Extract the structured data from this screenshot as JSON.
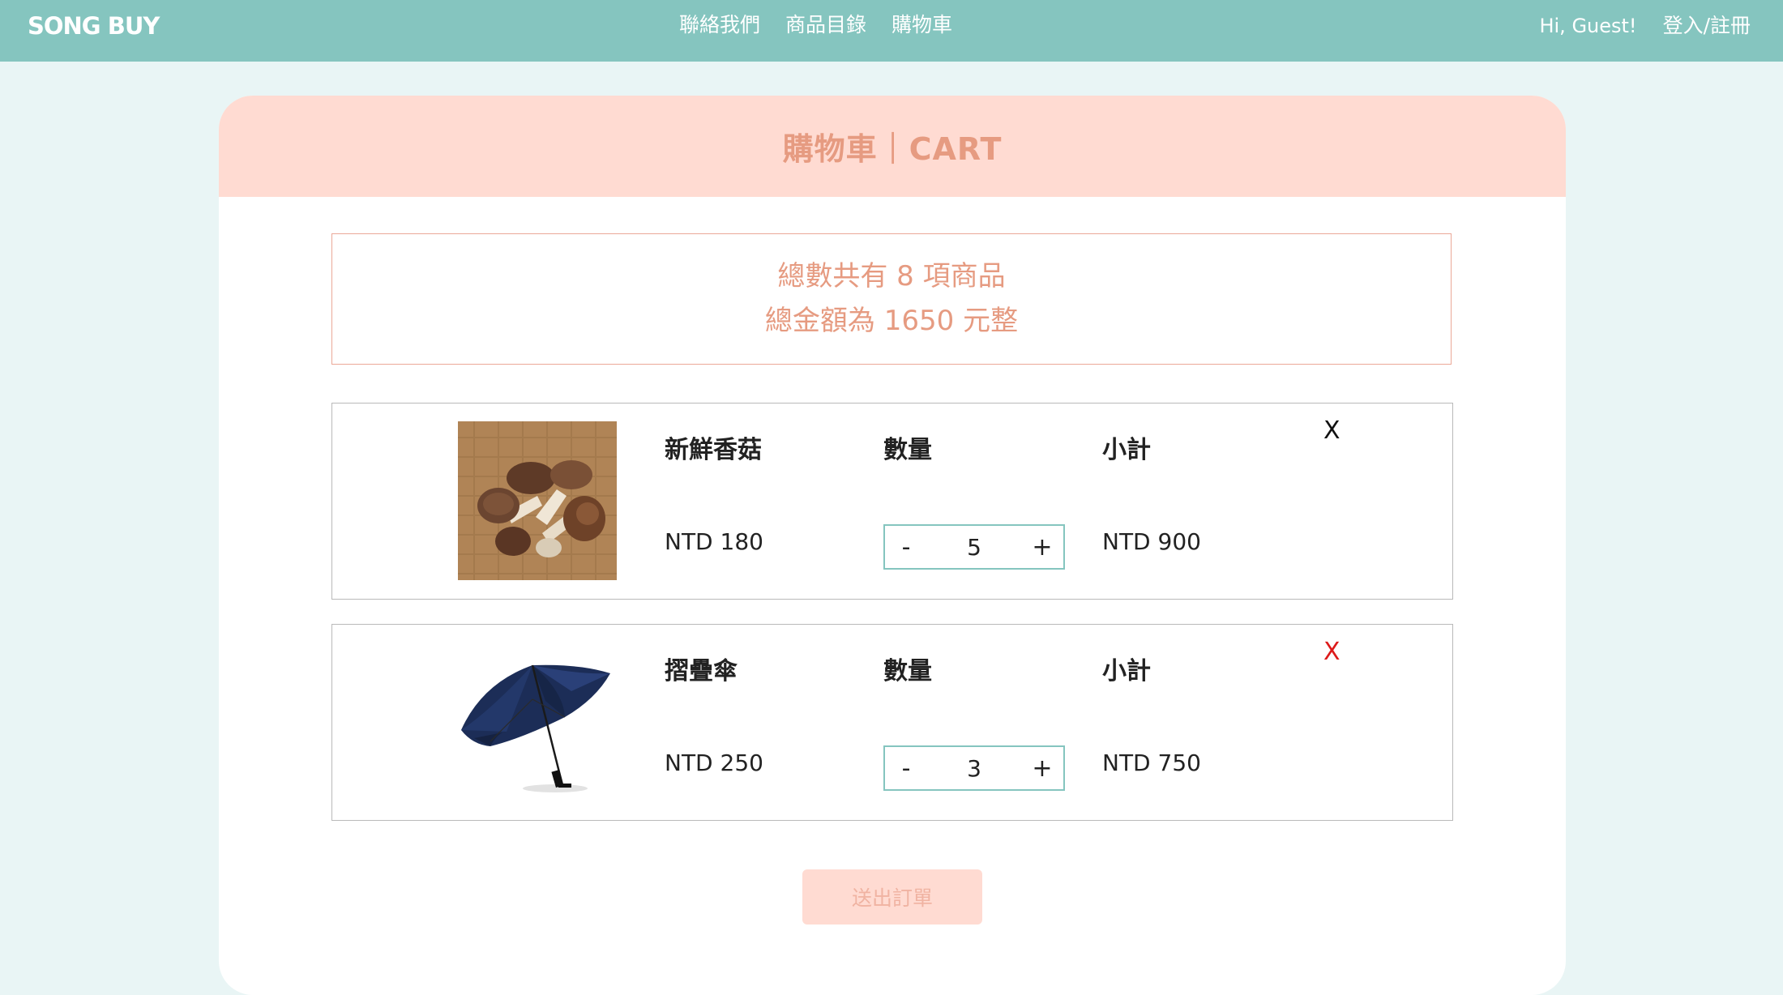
{
  "nav": {
    "brand": "SONG BUY",
    "links": [
      "聯絡我們",
      "商品目錄",
      "購物車"
    ],
    "greeting": "Hi, Guest!",
    "login": "登入/註冊"
  },
  "cart": {
    "title": "購物車｜CART",
    "summary_count": "總數共有 8 項商品",
    "summary_total": "總金額為 1650 元整",
    "qty_label": "數量",
    "subtotal_label": "小計",
    "remove_label": "X",
    "submit_label": "送出訂單",
    "items": [
      {
        "name": "新鮮香菇",
        "price": "NTD 180",
        "qty": "5",
        "subtotal": "NTD 900",
        "minus": "-",
        "plus": "+",
        "image": "mushroom-photo"
      },
      {
        "name": "摺疊傘",
        "price": "NTD 250",
        "qty": "3",
        "subtotal": "NTD 750",
        "minus": "-",
        "plus": "+",
        "image": "umbrella-photo"
      }
    ]
  },
  "colors": {
    "nav_bg": "#85c5bf",
    "page_bg": "#e9f5f5",
    "header_bg": "#ffdbd2",
    "accent_text": "#e69b81",
    "remove_red": "#dd1a1a"
  }
}
